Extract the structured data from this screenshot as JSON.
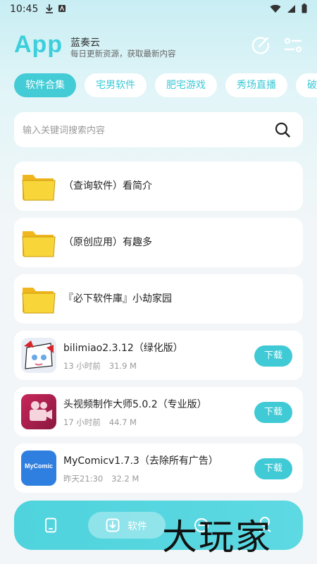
{
  "status_bar": {
    "time": "10:45"
  },
  "header": {
    "logo": "App",
    "title": "蓝奏云",
    "subtitle": "每日更新资源，获取最新内容"
  },
  "tabs": [
    {
      "label": "软件合集",
      "active": true
    },
    {
      "label": "宅男软件"
    },
    {
      "label": "肥宅游戏"
    },
    {
      "label": "秀场直播"
    },
    {
      "label": "破解"
    }
  ],
  "search": {
    "placeholder": "输入关键词搜索内容"
  },
  "folders": [
    {
      "title": "（查询软件）看简介"
    },
    {
      "title": "（原创应用）有趣多"
    },
    {
      "title": "『必下软件庫』小劫家园"
    }
  ],
  "apps": [
    {
      "title": "bilimiao2.3.12（绿化版）",
      "time": "13 小时前",
      "size": "31.9 M",
      "button": "下载"
    },
    {
      "title": "头视频制作大师5.0.2（专业版）",
      "time": "17 小时前",
      "size": "44.7 M",
      "button": "下载"
    },
    {
      "title": "MyComicv1.7.3（去除所有广告）",
      "time": "昨天21:30",
      "size": "32.2 M",
      "button": "下载",
      "icon_text": "MyComic"
    }
  ],
  "bottom_nav": {
    "active_label": "软件"
  },
  "watermark": "大玩家",
  "colors": {
    "accent": "#3fcad6",
    "folder": "#f6cd2b"
  }
}
